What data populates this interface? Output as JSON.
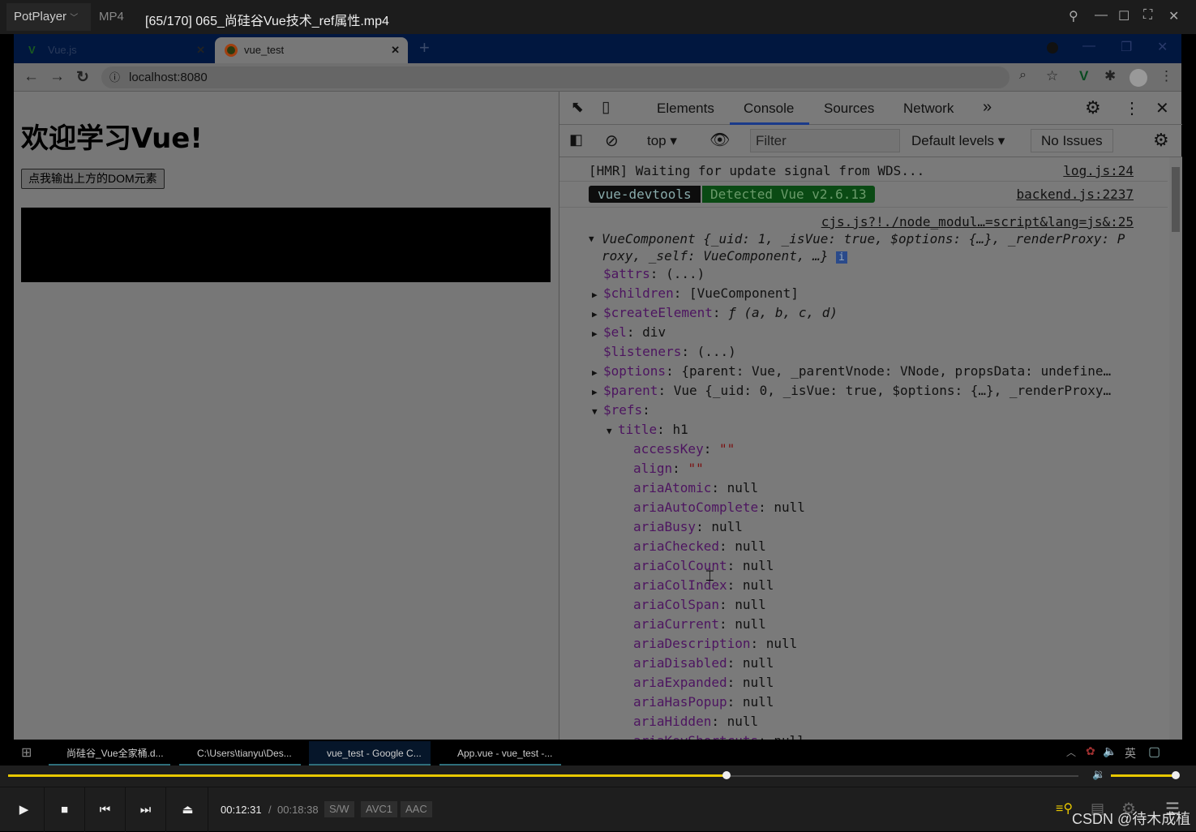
{
  "player": {
    "brand": "PotPlayer",
    "format": "MP4",
    "file_title": "[65/170] 065_尚硅谷Vue技术_ref属性.mp4",
    "current_time": "00:12:31",
    "separator": "/",
    "total_time": "00:18:38",
    "badges": [
      "S/W",
      "AVC1",
      "AAC"
    ],
    "progress_fraction": 0.671,
    "volume_fraction": 1.0,
    "accent": "#e8c800"
  },
  "browser": {
    "tabs": [
      {
        "label": "Vue.js",
        "active": false
      },
      {
        "label": "vue_test",
        "active": true
      }
    ],
    "url": "localhost:8080"
  },
  "page": {
    "heading": "欢迎学习Vue!",
    "button": "点我输出上方的DOM元素"
  },
  "devtools": {
    "tabs": [
      "Elements",
      "Console",
      "Sources",
      "Network"
    ],
    "active_tab": "Console",
    "context": "top",
    "filter_placeholder": "Filter",
    "levels": "Default levels",
    "issues": "No Issues"
  },
  "console": {
    "hmr": {
      "text": "[HMR] Waiting for update signal from WDS...",
      "source": "log.js:24"
    },
    "devtools_badge": {
      "left": "vue-devtools",
      "right": "Detected Vue v2.6.13",
      "source": "backend.js:2237"
    },
    "log_source": "cjs.js?!./node_modul…=script&lang=js&:25",
    "summary_1": "VueComponent {_uid: 1, _isVue: true, $options: {…}, _renderProxy: P",
    "summary_2": "roxy, _self: VueComponent, …}",
    "props": [
      {
        "arrow": "",
        "lvl": 1,
        "key": "$attrs",
        "val": "(...)"
      },
      {
        "arrow": "▶",
        "lvl": 1,
        "key": "$children",
        "val": "[VueComponent]"
      },
      {
        "arrow": "▶",
        "lvl": 1,
        "key": "$createElement",
        "val": "ƒ (a, b, c, d)"
      },
      {
        "arrow": "▶",
        "lvl": 1,
        "key": "$el",
        "val": "div"
      },
      {
        "arrow": "",
        "lvl": 1,
        "key": "$listeners",
        "val": "(...)"
      },
      {
        "arrow": "▶",
        "lvl": 1,
        "key": "$options",
        "val": "{parent: Vue, _parentVnode: VNode, propsData: undefine…"
      },
      {
        "arrow": "▶",
        "lvl": 1,
        "key": "$parent",
        "val": "Vue {_uid: 0, _isVue: true, $options: {…}, _renderProxy…"
      },
      {
        "arrow": "▼",
        "lvl": 1,
        "key": "$refs",
        "val": ""
      },
      {
        "arrow": "▼",
        "lvl": 2,
        "key": "title",
        "val": "h1"
      },
      {
        "arrow": "",
        "lvl": 3,
        "key": "accessKey",
        "val": "\"\""
      },
      {
        "arrow": "",
        "lvl": 3,
        "key": "align",
        "val": "\"\""
      },
      {
        "arrow": "",
        "lvl": 3,
        "key": "ariaAtomic",
        "val": "null"
      },
      {
        "arrow": "",
        "lvl": 3,
        "key": "ariaAutoComplete",
        "val": "null"
      },
      {
        "arrow": "",
        "lvl": 3,
        "key": "ariaBusy",
        "val": "null"
      },
      {
        "arrow": "",
        "lvl": 3,
        "key": "ariaChecked",
        "val": "null"
      },
      {
        "arrow": "",
        "lvl": 3,
        "key": "ariaColCount",
        "val": "null"
      },
      {
        "arrow": "",
        "lvl": 3,
        "key": "ariaColIndex",
        "val": "null"
      },
      {
        "arrow": "",
        "lvl": 3,
        "key": "ariaColSpan",
        "val": "null"
      },
      {
        "arrow": "",
        "lvl": 3,
        "key": "ariaCurrent",
        "val": "null"
      },
      {
        "arrow": "",
        "lvl": 3,
        "key": "ariaDescription",
        "val": "null"
      },
      {
        "arrow": "",
        "lvl": 3,
        "key": "ariaDisabled",
        "val": "null"
      },
      {
        "arrow": "",
        "lvl": 3,
        "key": "ariaExpanded",
        "val": "null"
      },
      {
        "arrow": "",
        "lvl": 3,
        "key": "ariaHasPopup",
        "val": "null"
      },
      {
        "arrow": "",
        "lvl": 3,
        "key": "ariaHidden",
        "val": "null"
      },
      {
        "arrow": "",
        "lvl": 3,
        "key": "ariaKeyShortcuts",
        "val": "null"
      }
    ]
  },
  "taskbar": {
    "items": [
      "尚硅谷_Vue全家桶.d...",
      "C:\\Users\\tianyu\\Des...",
      "vue_test - Google C...",
      "App.vue - vue_test -..."
    ],
    "ime": "英"
  },
  "watermark": "CSDN @待木成植"
}
